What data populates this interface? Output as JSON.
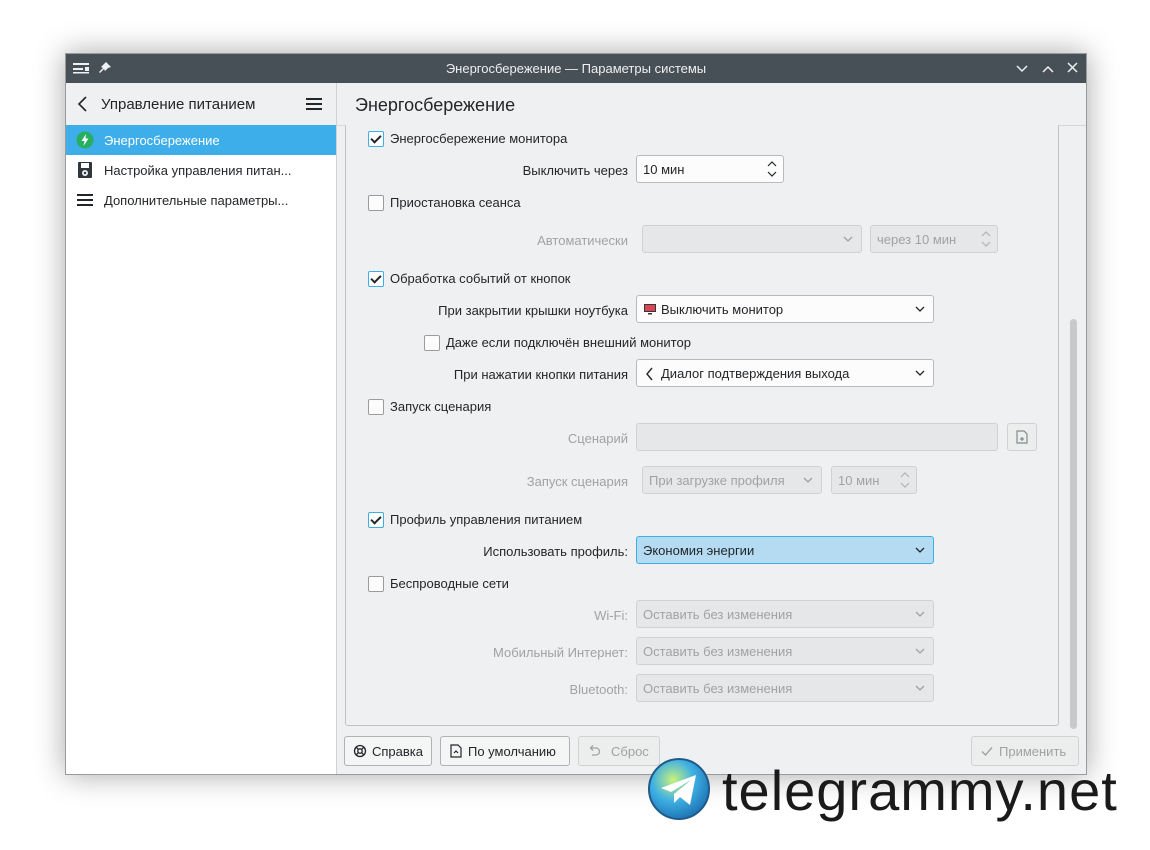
{
  "window": {
    "title": "Энергосбережение — Параметры системы"
  },
  "sidebar": {
    "title": "Управление питанием",
    "items": [
      {
        "label": "Энергосбережение",
        "icon": "lightning-icon",
        "active": true
      },
      {
        "label": "Настройка управления питан...",
        "icon": "floppy-gear-icon",
        "active": false
      },
      {
        "label": "Дополнительные параметры...",
        "icon": "list-icon",
        "active": false
      }
    ]
  },
  "main": {
    "page_title": "Энергосбережение"
  },
  "form": {
    "monitor": {
      "label": "Энергосбережение монитора",
      "checked": true
    },
    "turn_off_after": {
      "label": "Выключить через",
      "value": "10 мин"
    },
    "suspend": {
      "label": "Приостановка сеанса",
      "checked": false
    },
    "auto": {
      "label": "Автоматически",
      "combo": "",
      "spin": "через 10 мин"
    },
    "buttons": {
      "label": "Обработка событий от кнопок",
      "checked": true
    },
    "lid": {
      "label": "При закрытии крышки ноутбука",
      "value": "Выключить монитор"
    },
    "external": {
      "label": "Даже если подключён внешний монитор",
      "checked": false
    },
    "power_button": {
      "label": "При нажатии кнопки питания",
      "value": "Диалог подтверждения выхода"
    },
    "script": {
      "label": "Запуск сценария",
      "checked": false
    },
    "script_field": {
      "label": "Сценарий",
      "value": ""
    },
    "script_run": {
      "label": "Запуск сценария",
      "combo": "При загрузке профиля",
      "spin": "10 мин"
    },
    "profile": {
      "label": "Профиль управления питанием",
      "checked": true
    },
    "use_profile": {
      "label": "Использовать профиль:",
      "value": "Экономия энергии"
    },
    "wireless": {
      "label": "Беспроводные сети",
      "checked": false
    },
    "wifi": {
      "label": "Wi-Fi:",
      "value": "Оставить без изменения"
    },
    "mobile": {
      "label": "Мобильный Интернет:",
      "value": "Оставить без изменения"
    },
    "bluetooth": {
      "label": "Bluetooth:",
      "value": "Оставить без изменения"
    }
  },
  "footer": {
    "help": "Справка",
    "defaults": "По умолчанию",
    "reset": "Сброс",
    "apply": "Применить"
  },
  "watermark": {
    "text": "telegrammy.net"
  },
  "colors": {
    "accent": "#3daee9",
    "titlebar": "#475057",
    "selection": "#b4dbf1"
  }
}
